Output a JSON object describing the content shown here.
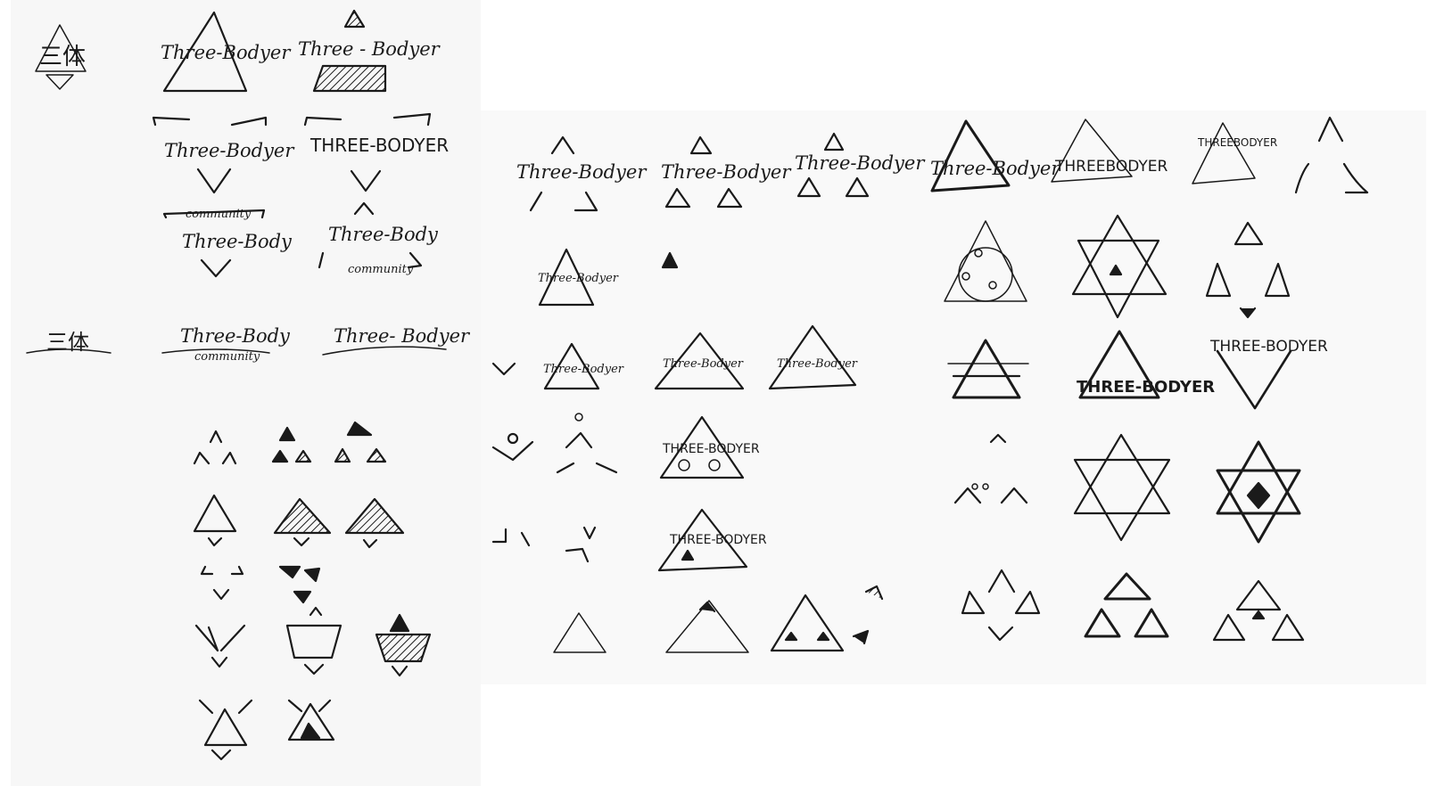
{
  "left_sheet": {
    "words": {
      "cn_mark": "三体",
      "three_bodyer_a": "Three-Bodyer",
      "three_bodyer_b": "Three - Bodyer",
      "three_bodyer_c": "Three-Bodyer",
      "three_bodyer_caps": "THREE-BODYER",
      "community_top": "community",
      "three_body_a": "Three-Body",
      "three_body_b": "Three-Body",
      "community_b": "community",
      "cn_wave": "三体",
      "three_body_wave": "Three-Body",
      "community_wave": "community",
      "three_bodyer_wave": "Three- Bodyer"
    }
  },
  "right_sheet": {
    "words": {
      "r1_a": "Three-Bodyer",
      "r1_b": "Three-Bodyer",
      "r1_c": "Three-Bodyer",
      "r1_d": "Three-Bodyer",
      "r1_e": "THREEBODYER",
      "r1_f": "THREEBODYER",
      "r2_a": "Three-Bodyer",
      "r3_a": "Three-Bodyer",
      "r3_b": "Three-Bodyer",
      "r3_c": "Three-Bodyer",
      "r3_d": "THREE-BODYER",
      "r3_e": "THREE-BODYER",
      "r4_a": "THREE-BODYER",
      "r5_a": "THREE-BODYER"
    }
  },
  "colors": {
    "ink": "#1a1a1a",
    "paper": "#f7f7f7",
    "background": "#ffffff"
  }
}
